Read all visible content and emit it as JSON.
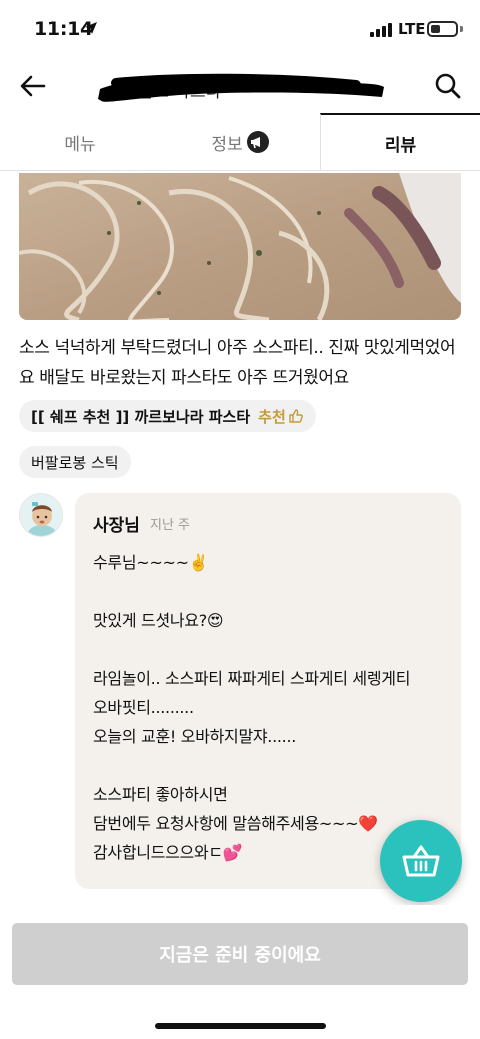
{
  "status_bar": {
    "time": "11:14",
    "network": "LTE",
    "battery_level": 0.4
  },
  "header": {
    "store_name": "버팔로 파스타"
  },
  "tabs": [
    {
      "label": "메뉴"
    },
    {
      "label": "정보"
    },
    {
      "label": "리뷰"
    }
  ],
  "review": {
    "text": "소스 넉넉하게 부탁드렸더니 아주 소스파티.. 진짜 맛있게먹었어요 배달도 바로왔는지 파스타도 아주 뜨거웠어요",
    "menu_items": [
      {
        "name": "[[ 쉐프 추천 ]] 까르보나라 파스타",
        "recommend_label": "추천"
      },
      {
        "name": "버팔로봉 스틱"
      }
    ]
  },
  "owner_reply": {
    "author": "사장님",
    "date": "지난 주",
    "body": "수루님~~~~✌️\n\n맛있게 드셧나요?😍\n\n라임놀이.. 소스파티 짜파게티 스파게티 세렝게티\n오바핏티.........\n오늘의 교훈! 오바하지말쟈......\n\n소스파티 좋아하시면\n담번에두 요청사항에 말씀해주세용~~~❤️\n감사합니드으으와ㄷ💕"
  },
  "order_button": {
    "label": "지금은 준비 중이에요"
  },
  "colors": {
    "accent": "#2bc1bc",
    "reply_bg": "#f4f1ec",
    "recommend": "#c59a3a",
    "disabled_button": "#cfcfcf"
  },
  "icons": {
    "back": "arrow-left-icon",
    "search": "search-icon",
    "info_badge": "megaphone-icon",
    "recommend": "thumbs-up-icon",
    "cart": "basket-icon"
  }
}
